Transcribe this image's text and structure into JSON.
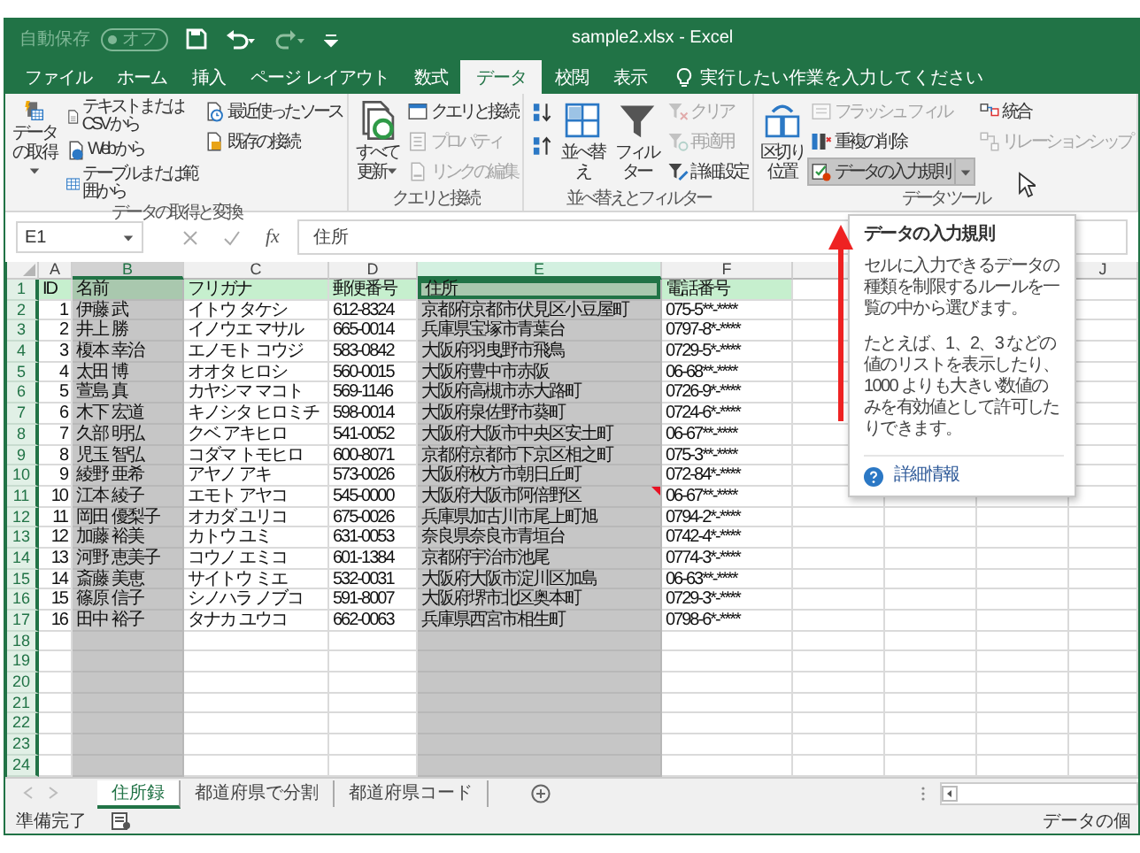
{
  "title_bar": {
    "autosave_label": "自動保存",
    "autosave_toggle": {
      "label": "オフ",
      "on": false
    },
    "title": "sample2.xlsx  -  Excel"
  },
  "tabs": [
    {
      "label": "ファイル",
      "selected": false
    },
    {
      "label": "ホーム",
      "selected": false
    },
    {
      "label": "挿入",
      "selected": false
    },
    {
      "label": "ページ レイアウト",
      "selected": false
    },
    {
      "label": "数式",
      "selected": false
    },
    {
      "label": "データ",
      "selected": true
    },
    {
      "label": "校閲",
      "selected": false
    },
    {
      "label": "表示",
      "selected": false
    }
  ],
  "tell_me": {
    "placeholder": "実行したい作業を入力してください"
  },
  "ribbon_groups": [
    {
      "label": "データの取得と変換",
      "columns": [
        [
          {
            "kind": "large",
            "label": "データの取得",
            "dropdown": true,
            "disabled": false,
            "hovered": false
          }
        ],
        [
          {
            "kind": "small",
            "label": "テキストまたは CSV から",
            "dropdown": false,
            "disabled": false,
            "hovered": false
          },
          {
            "kind": "small",
            "label": "Web から",
            "dropdown": false,
            "disabled": false,
            "hovered": false
          },
          {
            "kind": "small",
            "label": "テーブルまたは範囲から",
            "dropdown": false,
            "disabled": false,
            "hovered": false
          }
        ],
        [
          {
            "kind": "small",
            "label": "最近使ったソース",
            "dropdown": false,
            "disabled": false,
            "hovered": false
          },
          {
            "kind": "small",
            "label": "既存の接続",
            "dropdown": false,
            "disabled": false,
            "hovered": false
          }
        ]
      ]
    },
    {
      "label": "クエリと接続",
      "columns": [
        [
          {
            "kind": "large",
            "label": "すべて更新",
            "dropdown": true,
            "disabled": false,
            "hovered": false
          }
        ],
        [
          {
            "kind": "small",
            "label": "クエリと接続",
            "dropdown": false,
            "disabled": false,
            "hovered": false
          },
          {
            "kind": "small",
            "label": "プロパティ",
            "dropdown": false,
            "disabled": true,
            "hovered": false
          },
          {
            "kind": "small",
            "label": "リンクの編集",
            "dropdown": false,
            "disabled": true,
            "hovered": false
          }
        ]
      ]
    },
    {
      "label": "並べ替えとフィルター",
      "columns": [
        [
          {
            "kind": "icon",
            "disabled": false,
            "hovered": false
          },
          {
            "kind": "icon",
            "disabled": false,
            "hovered": false
          }
        ],
        [
          {
            "kind": "large",
            "label": "並べ替え",
            "dropdown": false,
            "disabled": false,
            "hovered": false
          }
        ],
        [
          {
            "kind": "large",
            "label": "フィルター",
            "dropdown": false,
            "disabled": false,
            "hovered": false
          }
        ],
        [
          {
            "kind": "small",
            "label": "クリア",
            "dropdown": false,
            "disabled": true,
            "hovered": false
          },
          {
            "kind": "small",
            "label": "再適用",
            "dropdown": false,
            "disabled": true,
            "hovered": false
          },
          {
            "kind": "small",
            "label": "詳細設定",
            "dropdown": false,
            "disabled": false,
            "hovered": false
          }
        ]
      ]
    },
    {
      "label": "データ ツール",
      "columns": [
        [
          {
            "kind": "large",
            "label": "区切り位置",
            "dropdown": false,
            "disabled": false,
            "hovered": false
          }
        ],
        [
          {
            "kind": "small",
            "label": "フラッシュ フィル",
            "dropdown": false,
            "disabled": true,
            "hovered": false
          },
          {
            "kind": "small",
            "label": "重複の削除",
            "dropdown": false,
            "disabled": false,
            "hovered": false
          },
          {
            "kind": "small",
            "label": "データの入力規則",
            "dropdown": true,
            "disabled": false,
            "hovered": true
          }
        ],
        [
          {
            "kind": "small",
            "label": "統合",
            "dropdown": false,
            "disabled": false,
            "hovered": false
          },
          {
            "kind": "small",
            "label": "リレーションシップ",
            "dropdown": false,
            "disabled": true,
            "hovered": false
          }
        ]
      ]
    }
  ],
  "formula_bar": {
    "name_box": "E1",
    "function_button": "fx",
    "formula": "住所"
  },
  "columns": [
    {
      "label": "A",
      "selected": false,
      "active": false
    },
    {
      "label": "B",
      "selected": true,
      "active": false
    },
    {
      "label": "C",
      "selected": false,
      "active": false
    },
    {
      "label": "D",
      "selected": false,
      "active": false
    },
    {
      "label": "E",
      "selected": true,
      "active": true
    },
    {
      "label": "F",
      "selected": false,
      "active": false
    },
    {
      "label": "J",
      "selected": false,
      "active": false
    }
  ],
  "rows": [
    {
      "number": "1",
      "header": true,
      "active": true,
      "note": false,
      "cells": [
        "ID",
        "名前",
        "フリガナ",
        "郵便番号",
        "住所",
        "電話番号"
      ]
    },
    {
      "number": "2",
      "header": false,
      "active": false,
      "note": false,
      "cells": [
        "1",
        "伊藤 武",
        "イトウ タケシ",
        "612-8324",
        "京都府京都市伏見区小豆屋町",
        "075-5**-****"
      ]
    },
    {
      "number": "3",
      "header": false,
      "active": false,
      "note": false,
      "cells": [
        "2",
        "井上 勝",
        "イノウエ マサル",
        "665-0014",
        "兵庫県宝塚市青葉台",
        "0797-8*-****"
      ]
    },
    {
      "number": "4",
      "header": false,
      "active": false,
      "note": false,
      "cells": [
        "3",
        "榎本 幸治",
        "エノモト コウジ",
        "583-0842",
        "大阪府羽曳野市飛鳥",
        "0729-5*-****"
      ]
    },
    {
      "number": "5",
      "header": false,
      "active": false,
      "note": false,
      "cells": [
        "4",
        "太田 博",
        "オオタ ヒロシ",
        "560-0015",
        "大阪府豊中市赤阪",
        "06-68**-****"
      ]
    },
    {
      "number": "6",
      "header": false,
      "active": false,
      "note": false,
      "cells": [
        "5",
        "萱島 真",
        "カヤシマ マコト",
        "569-1146",
        "大阪府高槻市赤大路町",
        "0726-9*-****"
      ]
    },
    {
      "number": "7",
      "header": false,
      "active": false,
      "note": false,
      "cells": [
        "6",
        "木下 宏道",
        "キノシタ ヒロミチ",
        "598-0014",
        "大阪府泉佐野市葵町",
        "0724-6*-****"
      ]
    },
    {
      "number": "8",
      "header": false,
      "active": false,
      "note": false,
      "cells": [
        "7",
        "久部 明弘",
        "クベ アキヒロ",
        "541-0052",
        "大阪府大阪市中央区安土町",
        "06-67**-****"
      ]
    },
    {
      "number": "9",
      "header": false,
      "active": false,
      "note": false,
      "cells": [
        "8",
        "児玉 智弘",
        "コダマ トモヒロ",
        "600-8071",
        "京都府京都市下京区相之町",
        "075-3**-****"
      ]
    },
    {
      "number": "10",
      "header": false,
      "active": false,
      "note": false,
      "cells": [
        "9",
        "綾野 亜希",
        "アヤノ アキ",
        "573-0026",
        "大阪府枚方市朝日丘町",
        "072-84*-****"
      ]
    },
    {
      "number": "11",
      "header": false,
      "active": false,
      "note": true,
      "cells": [
        "10",
        "江本 綾子",
        "エモト アヤコ",
        "545-0000",
        "大阪府大阪市阿倍野区",
        "06-67**-****"
      ]
    },
    {
      "number": "12",
      "header": false,
      "active": false,
      "note": false,
      "cells": [
        "11",
        "岡田 優梨子",
        "オカダ ユリコ",
        "675-0026",
        "兵庫県加古川市尾上町旭",
        "0794-2*-****"
      ]
    },
    {
      "number": "13",
      "header": false,
      "active": false,
      "note": false,
      "cells": [
        "12",
        "加藤 裕美",
        "カトウ ユミ",
        "631-0053",
        "奈良県奈良市青垣台",
        "0742-4*-****"
      ]
    },
    {
      "number": "14",
      "header": false,
      "active": false,
      "note": false,
      "cells": [
        "13",
        "河野 恵美子",
        "コウノ エミコ",
        "601-1384",
        "京都府宇治市池尾",
        "0774-3*-****"
      ]
    },
    {
      "number": "15",
      "header": false,
      "active": false,
      "note": false,
      "cells": [
        "14",
        "斎藤 美恵",
        "サイトウ ミエ",
        "532-0031",
        "大阪府大阪市淀川区加島",
        "06-63**-****"
      ]
    },
    {
      "number": "16",
      "header": false,
      "active": false,
      "note": false,
      "cells": [
        "15",
        "篠原 信子",
        "シノハラ ノブコ",
        "591-8007",
        "大阪府堺市北区奥本町",
        "0729-3*-****"
      ]
    },
    {
      "number": "17",
      "header": false,
      "active": false,
      "note": false,
      "cells": [
        "16",
        "田中 裕子",
        "タナカ ユウコ",
        "662-0063",
        "兵庫県西宮市相生町",
        "0798-6*-****"
      ]
    },
    {
      "number": "18",
      "header": false,
      "active": false,
      "note": false
    },
    {
      "number": "19",
      "header": false,
      "active": false,
      "note": false
    },
    {
      "number": "20",
      "header": false,
      "active": false,
      "note": false
    },
    {
      "number": "21",
      "header": false,
      "active": false,
      "note": false
    },
    {
      "number": "22",
      "header": false,
      "active": false,
      "note": false
    },
    {
      "number": "23",
      "header": false,
      "active": false,
      "note": false
    },
    {
      "number": "24",
      "header": false,
      "active": false,
      "note": false
    }
  ],
  "tooltip": {
    "title": "データの入力規則",
    "paragraphs": [
      "セルに入力できるデータの種類を制限するルールを一覧の中から選びます。",
      "たとえば、1、2、3 などの値のリストを表示したり、1000 よりも大きい数値のみを有効値として許可したりできます。"
    ],
    "link": "詳細情報"
  },
  "sheet_tabs": [
    {
      "label": "住所録",
      "selected": true
    },
    {
      "label": "都道府県で分割",
      "selected": false
    },
    {
      "label": "都道府県コード",
      "selected": false
    }
  ],
  "status_bar": {
    "left": "準備完了",
    "right": "データの個"
  }
}
